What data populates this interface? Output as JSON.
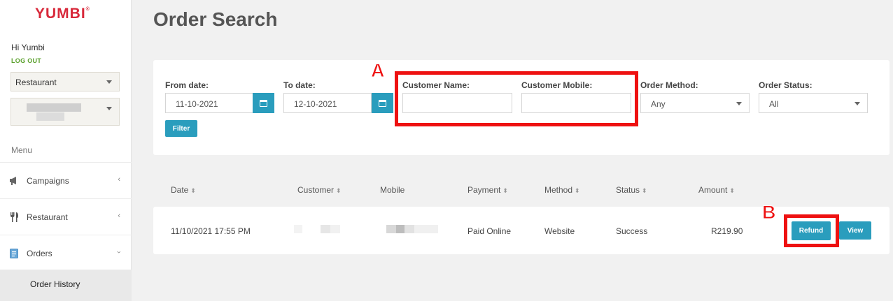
{
  "sidebar": {
    "logo": "YUMBI",
    "greeting": "Hi Yumbi",
    "logout": "LOG OUT",
    "restaurant_select": "Restaurant",
    "menu_label": "Menu",
    "items": [
      {
        "label": "Campaigns",
        "icon": "megaphone-icon"
      },
      {
        "label": "Restaurant",
        "icon": "cutlery-icon"
      },
      {
        "label": "Orders",
        "icon": "document-icon"
      }
    ],
    "sub_item": "Order History"
  },
  "page": {
    "title": "Order Search"
  },
  "filters": {
    "from_label": "From date:",
    "from_value": "11-10-2021",
    "to_label": "To date:",
    "to_value": "12-10-2021",
    "customer_name_label": "Customer Name:",
    "customer_mobile_label": "Customer Mobile:",
    "order_method_label": "Order Method:",
    "order_method_value": "Any",
    "order_status_label": "Order Status:",
    "order_status_value": "All",
    "filter_button": "Filter"
  },
  "table": {
    "headers": [
      "Date",
      "Customer",
      "Mobile",
      "Payment",
      "Method",
      "Status",
      "Amount"
    ],
    "row": {
      "date": "11/10/2021 17:55 PM",
      "payment": "Paid Online",
      "method": "Website",
      "status": "Success",
      "amount": "R219.90",
      "refund_label": "Refund",
      "view_label": "View"
    }
  },
  "annotations": {
    "a": "A",
    "b": "B"
  },
  "colors": {
    "accent": "#2a9dbd",
    "brand": "#d8283a",
    "annotation": "#ee1111",
    "logout": "#5aa02c"
  }
}
